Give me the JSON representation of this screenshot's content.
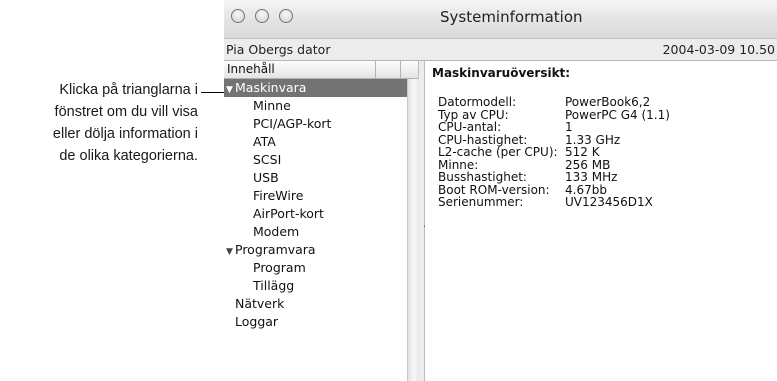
{
  "callout": {
    "lines": [
      "Klicka på trianglarna i",
      "fönstret om du vill visa",
      "eller dölja information i",
      "de olika kategorierna."
    ]
  },
  "window": {
    "title": "Systeminformation",
    "computer_name": "Pia Obergs dator",
    "datetime": "2004-03-09 10.50"
  },
  "sidebar": {
    "header": "Innehåll",
    "items": [
      {
        "label": "Maskinvara",
        "expanded": true,
        "selected": true
      },
      {
        "label": "Minne"
      },
      {
        "label": "PCI/AGP-kort"
      },
      {
        "label": "ATA"
      },
      {
        "label": "SCSI"
      },
      {
        "label": "USB"
      },
      {
        "label": "FireWire"
      },
      {
        "label": "AirPort-kort"
      },
      {
        "label": "Modem"
      },
      {
        "label": "Programvara",
        "expanded": true
      },
      {
        "label": "Program"
      },
      {
        "label": "Tillägg"
      },
      {
        "label": "Nätverk"
      },
      {
        "label": "Loggar"
      }
    ]
  },
  "main": {
    "title": "Maskinvaruöversikt:",
    "rows": [
      {
        "key": "Datormodell:",
        "value": "PowerBook6,2"
      },
      {
        "key": "Typ av CPU:",
        "value": "PowerPC G4 (1.1)"
      },
      {
        "key": "CPU-antal:",
        "value": "1"
      },
      {
        "key": "CPU-hastighet:",
        "value": "1.33 GHz"
      },
      {
        "key": "L2-cache (per CPU):",
        "value": "512 K"
      },
      {
        "key": "Minne:",
        "value": "256 MB"
      },
      {
        "key": "Busshastighet:",
        "value": "133 MHz"
      },
      {
        "key": "Boot ROM-version:",
        "value": "4.67bb"
      },
      {
        "key": "Serienummer:",
        "value": "UV123456D1X"
      }
    ]
  }
}
